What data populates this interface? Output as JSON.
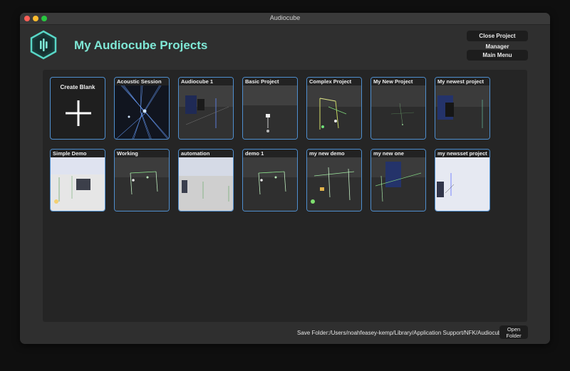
{
  "window": {
    "title": "Audiocube"
  },
  "header": {
    "title": "My Audiocube Projects",
    "close_button": "Close Project Manager",
    "main_menu_button": "Main Menu"
  },
  "create_blank": {
    "label": "Create Blank"
  },
  "projects": [
    {
      "name": "Acoustic Session",
      "thumb": "blue-rays"
    },
    {
      "name": "Audiocube 1",
      "thumb": "dark-grid-speaker"
    },
    {
      "name": "Basic Project",
      "thumb": "dark-single"
    },
    {
      "name": "Complex Project",
      "thumb": "dark-yellow-lines"
    },
    {
      "name": "My New Project",
      "thumb": "dark-sparse"
    },
    {
      "name": "My newest project",
      "thumb": "dark-blue-panel"
    },
    {
      "name": "Simple Demo",
      "thumb": "bright-room"
    },
    {
      "name": "Working",
      "thumb": "dark-green-lines"
    },
    {
      "name": "automation",
      "thumb": "bright-sparse"
    },
    {
      "name": "demo 1",
      "thumb": "dark-green-lines"
    },
    {
      "name": "my new demo",
      "thumb": "dark-green-dense"
    },
    {
      "name": "my new one",
      "thumb": "dark-blue-panel-2"
    },
    {
      "name": "my newsset project",
      "thumb": "bright-blue"
    }
  ],
  "footer": {
    "save_folder": "Save Folder:/Users/noahfeasey-kemp/Library/Application Support/NFK/Audiocube",
    "open_folder_button": "Open Folder"
  },
  "colors": {
    "accent": "#7fe8d6",
    "tile_border": "#4f8fcf"
  }
}
